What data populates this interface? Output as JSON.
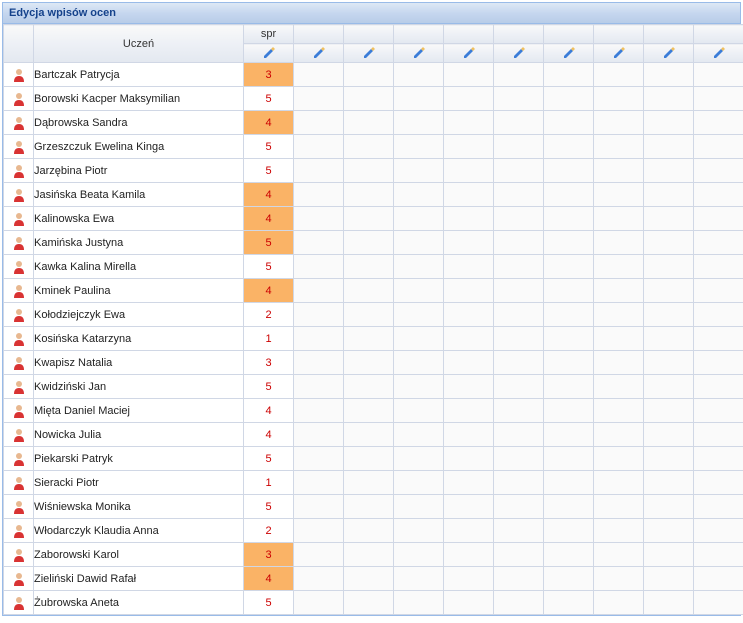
{
  "panel": {
    "title": "Edycja wpisów ocen"
  },
  "headers": {
    "student": "Uczeń",
    "grade_cols": [
      "spr",
      "",
      "",
      "",
      "",
      "",
      "",
      "",
      "",
      ""
    ]
  },
  "students": [
    {
      "name": "Bartczak Patrycja",
      "grade": "3",
      "highlight": true
    },
    {
      "name": "Borowski Kacper Maksymilian",
      "grade": "5",
      "highlight": false
    },
    {
      "name": "Dąbrowska Sandra",
      "grade": "4",
      "highlight": true
    },
    {
      "name": "Grzeszczuk Ewelina Kinga",
      "grade": "5",
      "highlight": false
    },
    {
      "name": "Jarzębina Piotr",
      "grade": "5",
      "highlight": false
    },
    {
      "name": "Jasińska Beata Kamila",
      "grade": "4",
      "highlight": true
    },
    {
      "name": "Kalinowska Ewa",
      "grade": "4",
      "highlight": true
    },
    {
      "name": "Kamińska Justyna",
      "grade": "5",
      "highlight": true
    },
    {
      "name": "Kawka Kalina Mirella",
      "grade": "5",
      "highlight": false
    },
    {
      "name": "Kminek Paulina",
      "grade": "4",
      "highlight": true
    },
    {
      "name": "Kołodziejczyk Ewa",
      "grade": "2",
      "highlight": false
    },
    {
      "name": "Kosińska Katarzyna",
      "grade": "1",
      "highlight": false
    },
    {
      "name": "Kwapisz Natalia",
      "grade": "3",
      "highlight": false
    },
    {
      "name": "Kwidziński Jan",
      "grade": "5",
      "highlight": false
    },
    {
      "name": "Mięta Daniel Maciej",
      "grade": "4",
      "highlight": false
    },
    {
      "name": "Nowicka Julia",
      "grade": "4",
      "highlight": false
    },
    {
      "name": "Piekarski Patryk",
      "grade": "5",
      "highlight": false
    },
    {
      "name": "Sieracki Piotr",
      "grade": "1",
      "highlight": false
    },
    {
      "name": "Wiśniewska Monika",
      "grade": "5",
      "highlight": false
    },
    {
      "name": "Włodarczyk Klaudia Anna",
      "grade": "2",
      "highlight": false
    },
    {
      "name": "Zaborowski Karol",
      "grade": "3",
      "highlight": true
    },
    {
      "name": "Zieliński Dawid Rafał",
      "grade": "4",
      "highlight": true
    },
    {
      "name": "Żubrowska Aneta",
      "grade": "5",
      "highlight": false
    }
  ]
}
